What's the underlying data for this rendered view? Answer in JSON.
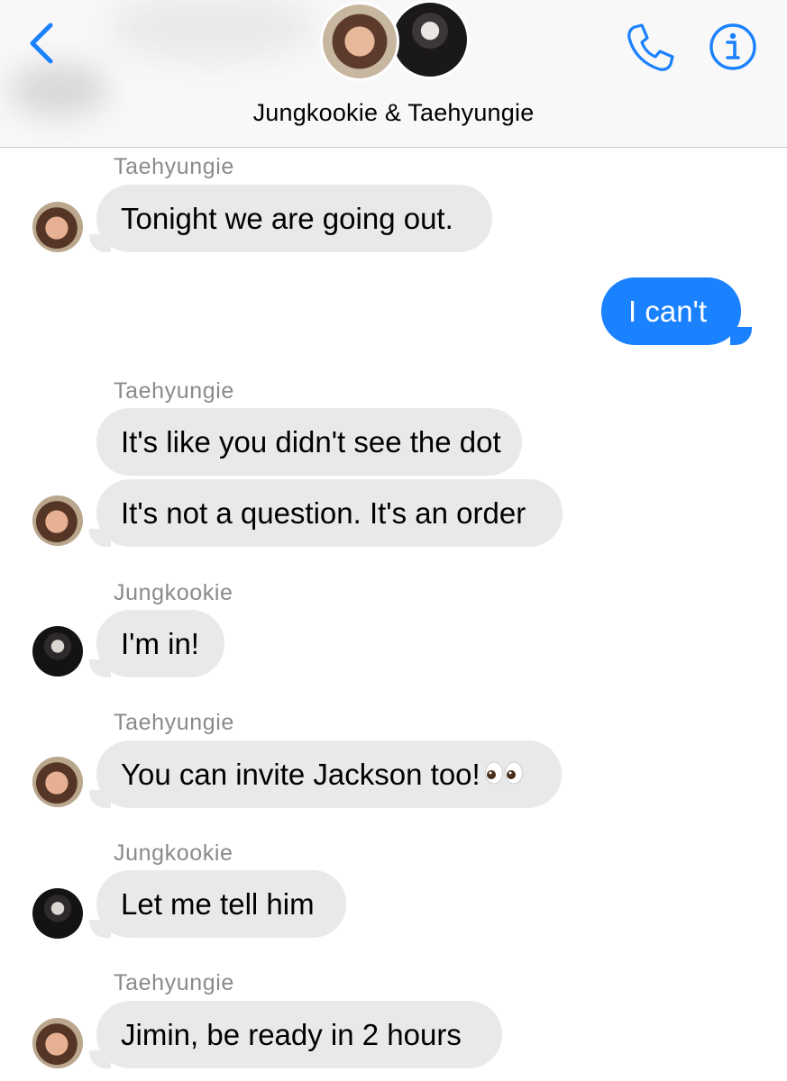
{
  "header": {
    "title": "Jungkookie & Taehyungie",
    "back_icon": "chevron-left-icon",
    "call_icon": "phone-icon",
    "info_icon": "info-icon",
    "accent_color": "#1a81ff"
  },
  "messages": [
    {
      "sender": "Taehyungie",
      "text": "Tonight we are going out."
    },
    {
      "text": "I can't"
    },
    {
      "sender": "Taehyungie",
      "text": "It's like you didn't see the dot"
    },
    {
      "text": "It's not a question. It's an order"
    },
    {
      "sender": "Jungkookie",
      "text": "I'm in!"
    },
    {
      "sender": "Taehyungie",
      "text": "You can invite Jackson too!",
      "emoji": "eyes-emoji"
    },
    {
      "sender": "Jungkookie",
      "text": "Let me tell him"
    },
    {
      "sender": "Taehyungie",
      "text": "Jimin, be ready in 2 hours"
    }
  ],
  "colors": {
    "incoming_bubble": "#e9e9eb",
    "outgoing_bubble": "#1a81ff",
    "sender_name": "#8a8a8e"
  }
}
